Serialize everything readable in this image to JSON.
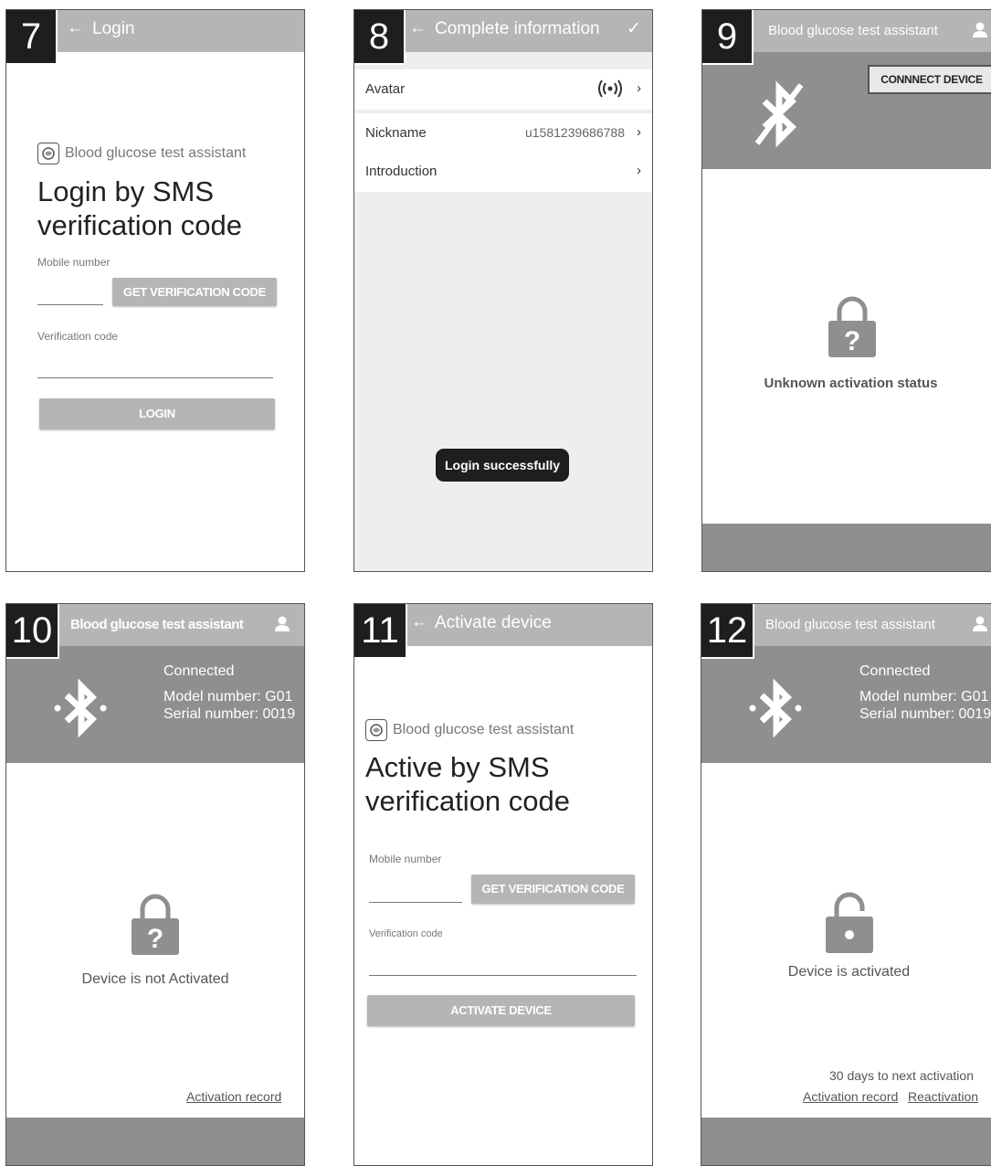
{
  "screens": {
    "s7": {
      "number": "7",
      "header_title": "Login",
      "app_name": "Blood glucose test assistant",
      "title": "Login by SMS verification code",
      "mobile_label": "Mobile number",
      "mobile_value": "",
      "get_code_label": "GET VERIFICATION CODE",
      "code_label": "Verification code",
      "code_value": "",
      "login_label": "LOGIN"
    },
    "s8": {
      "number": "8",
      "header_title": "Complete information",
      "rows": [
        {
          "label": "Avatar",
          "value": ""
        },
        {
          "label": "Nickname",
          "value": "u1581239686788"
        },
        {
          "label": "Introduction",
          "value": ""
        }
      ],
      "toast": "Login successfully"
    },
    "s9": {
      "number": "9",
      "header_title": "Blood glucose test assistant",
      "connect_label": "CONNNECT DEVICE",
      "status": "Unknown activation status"
    },
    "s10": {
      "number": "10",
      "header_title": "Blood glucose test assistant",
      "connection": "Connected",
      "model": "Model number: G01",
      "serial": "Serial number: 0019",
      "status": "Device is not Activated",
      "record_link": "Activation record"
    },
    "s11": {
      "number": "11",
      "header_title": "Activate device",
      "app_name": "Blood glucose test assistant",
      "title": "Active by SMS verification code",
      "mobile_label": "Mobile number",
      "mobile_value": "",
      "get_code_label": "GET VERIFICATION CODE",
      "code_label": "Verification code",
      "code_value": "",
      "activate_label": "ACTIVATE DEVICE"
    },
    "s12": {
      "number": "12",
      "header_title": "Blood glucose test assistant",
      "connection": "Connected",
      "model": "Model number: G01",
      "serial": "Serial number: 0019",
      "status": "Device is activated",
      "days_note": "30 days to next activation",
      "record_link": "Activation record",
      "reactivation_link": "Reactivation"
    }
  },
  "icons": {
    "back": "back-arrow-icon",
    "check": "checkmark-icon",
    "user": "user-icon",
    "bluetooth": "bluetooth-icon",
    "bluetooth_off": "bluetooth-disabled-icon",
    "lock_unknown": "lock-question-icon",
    "lock_open": "unlocked-icon",
    "signal": "broadcast-icon",
    "chevron": "chevron-right-icon",
    "app_logo": "app-logo-icon"
  },
  "colors": {
    "header_grey": "#b5b5b5",
    "band_grey": "#8f8f8f",
    "badge_black": "#1e1e1e"
  }
}
